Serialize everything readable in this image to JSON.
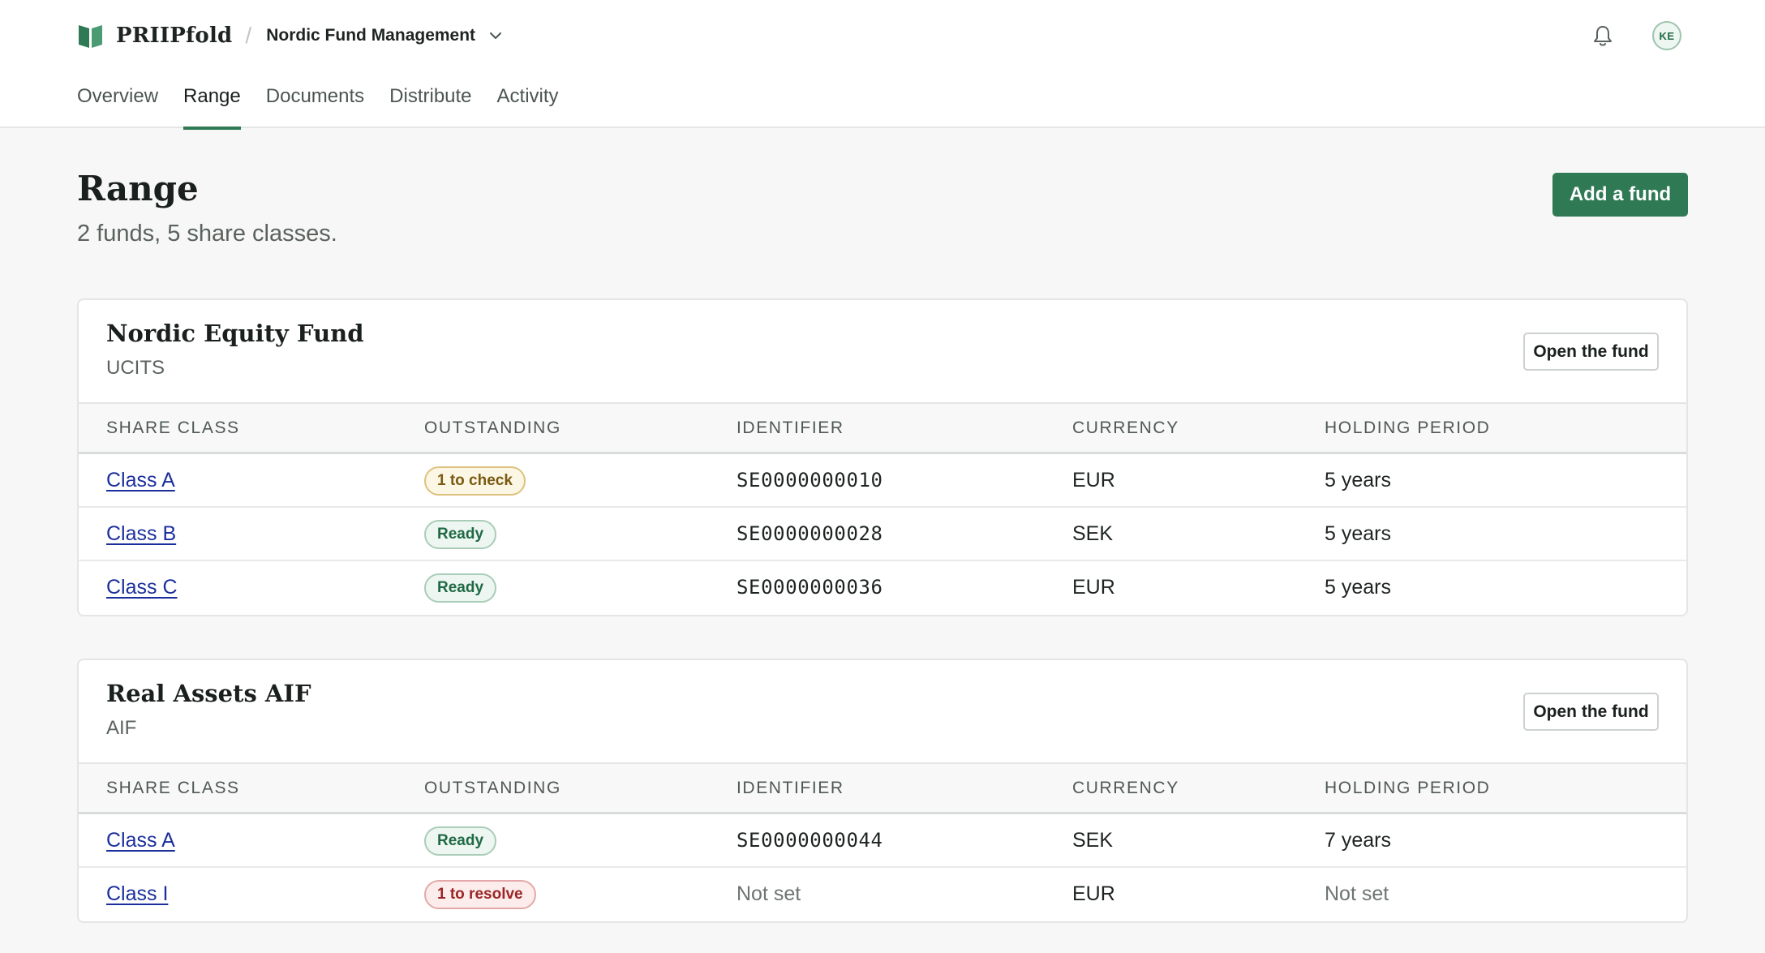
{
  "brand": {
    "name": "PRIIPfold",
    "separator": "/",
    "org": "Nordic Fund Management"
  },
  "user": {
    "initials": "KE"
  },
  "tabs": [
    "Overview",
    "Range",
    "Documents",
    "Distribute",
    "Activity"
  ],
  "active_tab": "Range",
  "page": {
    "title": "Range",
    "subtitle": "2 funds, 5 share classes.",
    "add_button": "Add a fund"
  },
  "table_headers": {
    "share_class": "SHARE CLASS",
    "outstanding": "OUTSTANDING",
    "identifier": "IDENTIFIER",
    "currency": "CURRENCY",
    "holding_period": "HOLDING PERIOD"
  },
  "funds": [
    {
      "name": "Nordic Equity Fund",
      "type": "UCITS",
      "open_button": "Open the fund",
      "rows": [
        {
          "share_class": "Class A",
          "status": "1 to check",
          "identifier": "SE0000000010",
          "currency": "EUR",
          "holding_period": "5 years"
        },
        {
          "share_class": "Class B",
          "status": "Ready",
          "identifier": "SE0000000028",
          "currency": "SEK",
          "holding_period": "5 years"
        },
        {
          "share_class": "Class C",
          "status": "Ready",
          "identifier": "SE0000000036",
          "currency": "EUR",
          "holding_period": "5 years"
        }
      ]
    },
    {
      "name": "Real Assets AIF",
      "type": "AIF",
      "open_button": "Open the fund",
      "rows": [
        {
          "share_class": "Class A",
          "status": "Ready",
          "identifier": "SE0000000044",
          "currency": "SEK",
          "holding_period": "7 years"
        },
        {
          "share_class": "Class I",
          "status": "1 to resolve",
          "identifier": "Not set",
          "currency": "EUR",
          "holding_period": "Not set"
        }
      ]
    }
  ],
  "colors": {
    "accent": "#2f7a55",
    "link": "#1b2f9c",
    "ready": "#1f6a45",
    "check": "#7a5a12",
    "resolve": "#9c2626"
  },
  "icons": {
    "logo": "book-logo-icon",
    "org_dropdown": "chevron-down-icon",
    "notifications": "bell-icon"
  }
}
